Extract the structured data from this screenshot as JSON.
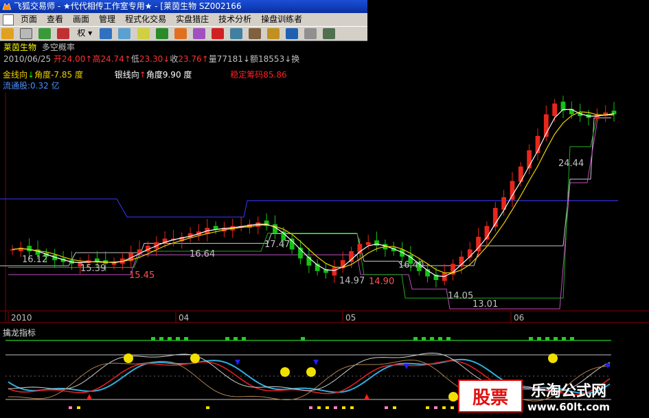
{
  "window": {
    "title": "飞狐交易师 - ★代代相传工作室专用★ - [莱茵生物 SZ002166",
    "app_icon": "fox-app-icon"
  },
  "menu": [
    "页面",
    "查看",
    "画面",
    "管理",
    "程式化交易",
    "实盘猎庄",
    "技术分析",
    "操盘训练者"
  ],
  "toolbar": {
    "quan_label": "权",
    "icons": [
      "open-folder-icon",
      "rsi-icon",
      "move-icon",
      "swap-icon",
      "weight-dropdown",
      "ab-icon",
      "double-circle-icon",
      "calendar-icon",
      "grid-icon",
      "fox-icon",
      "pie-icon",
      "alarm-icon",
      "monitor-icon",
      "book-icon",
      "paint-icon",
      "chart-icon",
      "window-icon",
      "table-icon"
    ]
  },
  "stock": {
    "name": "莱茵生物",
    "indicator": "多空概率",
    "date": "2010/06/25",
    "open_label": "开",
    "open": "24.00",
    "high_label": "高",
    "high": "24.74",
    "low_label": "低",
    "low": "23.30",
    "close_label": "收",
    "close": "23.76",
    "vol_label": "量",
    "vol": "77181",
    "amt_label": "额",
    "amt": "18553",
    "turn_label": "换",
    "gold_label": "金线向",
    "gold_angle": "角度-7.85 度",
    "silver_label": "银线向",
    "silver_angle": "角度9.90 度",
    "chip_label": "稳定筹码",
    "chip_value": "85.86",
    "float_label": "流通股:",
    "float_value": "0.32 亿"
  },
  "price_labels": [
    "16.12",
    "15.39",
    "15.45",
    "16.64",
    "17.47",
    "14.97",
    "14.90",
    "16.40",
    "14.05",
    "13.01",
    "24.44"
  ],
  "time_axis": [
    "2010",
    "04",
    "05",
    "06"
  ],
  "sub_indicator": "擒龙指标",
  "watermark": {
    "left": "股票",
    "right_title": "乐淘公式网",
    "right_url": "www.60lt.com"
  },
  "colors": {
    "up": "#e8261b",
    "down": "#14c214",
    "accent_red": "#ff3030",
    "accent_green": "#00e000",
    "info_text": "#f0d000",
    "gray": "#c0c0c0"
  },
  "chart_data": {
    "type": "candlestick",
    "title": "莱茵生物 SZ002166",
    "x": [
      "2010",
      "04",
      "05",
      "06"
    ],
    "ylim": [
      13,
      25
    ],
    "series": [
      {
        "name": "close",
        "values": [
          16.3,
          16.4,
          16.2,
          16.0,
          15.9,
          15.7,
          15.6,
          15.5,
          15.6,
          15.7,
          15.6,
          15.5,
          15.6,
          15.8,
          16.1,
          16.3,
          16.5,
          16.7,
          16.9,
          16.9,
          17.0,
          17.2,
          17.3,
          17.5,
          17.4,
          17.5,
          17.6,
          17.6,
          17.7,
          17.8,
          17.6,
          17.2,
          16.8,
          16.3,
          15.8,
          15.4,
          15.1,
          15.0,
          15.3,
          15.7,
          16.2,
          16.6,
          16.7,
          16.5,
          16.3,
          16.2,
          15.9,
          15.5,
          15.1,
          14.8,
          14.6,
          15.0,
          15.5,
          15.9,
          16.3,
          17.0,
          17.6,
          18.6,
          19.2,
          20.1,
          20.9,
          21.8,
          22.6,
          23.8,
          24.4,
          24.0,
          23.8,
          23.7,
          23.6,
          23.8,
          23.9,
          23.8
        ]
      }
    ],
    "key_levels": [
      16.12,
      15.39,
      15.45,
      16.64,
      17.47,
      14.97,
      14.9,
      16.4,
      14.05,
      13.01,
      24.44
    ]
  }
}
